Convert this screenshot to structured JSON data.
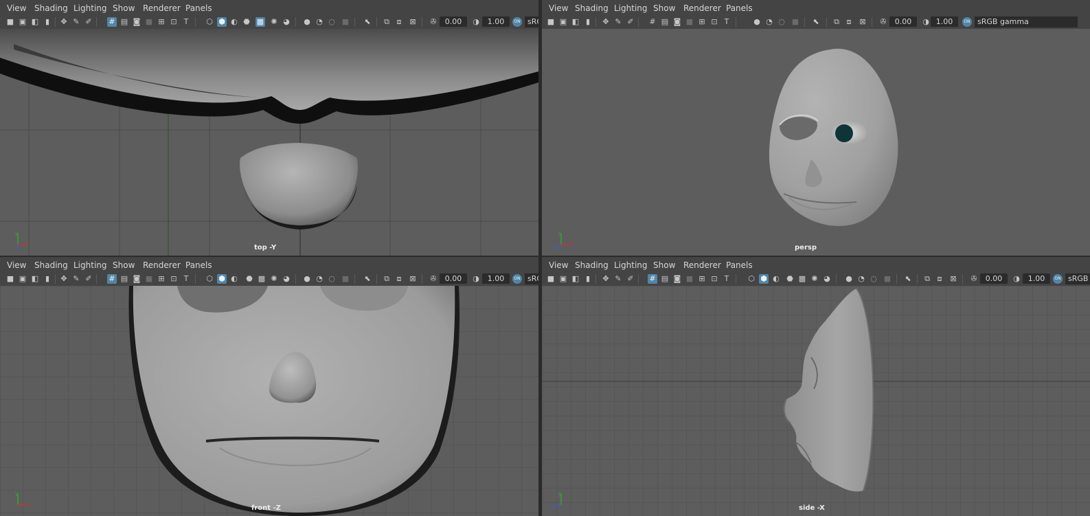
{
  "menus": [
    "View",
    "Shading",
    "Lighting",
    "Show",
    "Renderer",
    "Panels"
  ],
  "icons": [
    "camera-icon",
    "camera-attributes-icon",
    "bookmark-icon",
    "image-plane-icon",
    "two-d-pan-zoom-icon",
    "grease-pencil-icon",
    "grid-icon",
    "film-gate-icon",
    "resolution-gate-icon",
    "gate-mask-icon",
    "field-chart-icon",
    "safe-action-icon",
    "safe-title-icon",
    "wireframe-icon",
    "smooth-shade-icon",
    "default-material-icon",
    "wireframe-on-shaded-icon",
    "xray-icon",
    "lights-icon",
    "shadows-icon",
    "screen-space-ao-icon",
    "motion-blur-icon",
    "multisample-aa-icon",
    "depth-of-field-icon",
    "isolate-select-icon",
    "xray-joints-icon",
    "xray-active-components-icon",
    "backface-culling-icon",
    "exposure-icon",
    "gamma-icon",
    "color-management-icon"
  ],
  "viewports": [
    {
      "camera": "top -Y",
      "exposure": "0.00",
      "gamma": "1.00",
      "color_toggle": "ON",
      "colorspace": "sRGB gamma",
      "axis": {
        "up": "y",
        "right": "x"
      }
    },
    {
      "camera": "persp",
      "exposure": "0.00",
      "gamma": "1.00",
      "color_toggle": "ON",
      "colorspace": "sRGB gamma",
      "axis": {
        "up": "y",
        "right": "x",
        "depth": "z"
      }
    },
    {
      "camera": "front -Z",
      "exposure": "0.00",
      "gamma": "1.00",
      "color_toggle": "ON",
      "colorspace": "sRGB gamma",
      "axis": {
        "up": "y",
        "right": "x"
      }
    },
    {
      "camera": "side -X",
      "exposure": "0.00",
      "gamma": "1.00",
      "color_toggle": "ON",
      "colorspace": "sRGB gamma",
      "axis": {
        "up": "y",
        "right": "z"
      }
    }
  ],
  "colors": {
    "panel": "#444444",
    "viewport_background": "#5d5d5d",
    "active_toggle": "#5285a6",
    "eye_iris": "#0e3438"
  }
}
